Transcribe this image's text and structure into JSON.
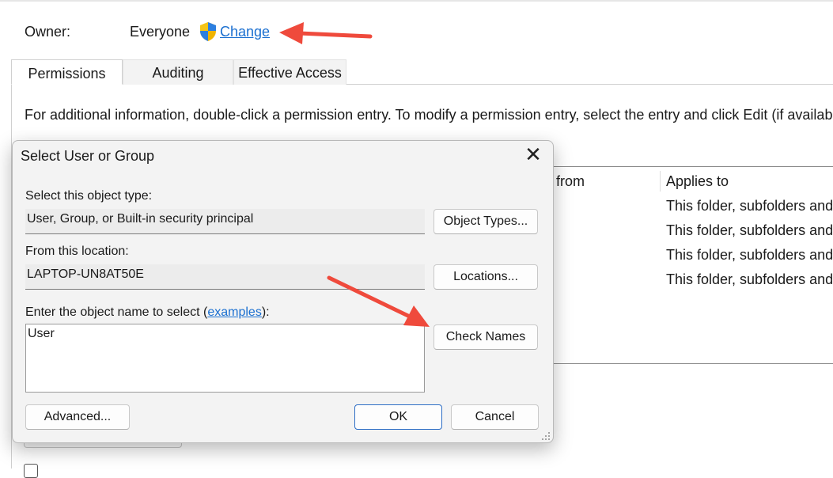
{
  "owner": {
    "label": "Owner:",
    "value": "Everyone",
    "change_link": "Change",
    "shield_icon": "uac-shield-icon"
  },
  "tabs": [
    {
      "label": "Permissions",
      "active": true
    },
    {
      "label": "Auditing",
      "active": false
    },
    {
      "label": "Effective Access",
      "active": false
    }
  ],
  "info_text": "For additional information, double-click a permission entry. To modify a permission entry, select the entry and click Edit (if availab",
  "permissions_list": {
    "columns": [
      "from",
      "Applies to"
    ],
    "rows": [
      {
        "applies_to": "This folder, subfolders and"
      },
      {
        "applies_to": "This folder, subfolders and"
      },
      {
        "applies_to": "This folder, subfolders and"
      },
      {
        "applies_to": "This folder, subfolders and"
      }
    ]
  },
  "dialog": {
    "title": "Select User or Group",
    "close_icon": "close-icon",
    "object_type_label": "Select this object type:",
    "object_type_value": "User, Group, or Built-in security principal",
    "object_types_button": "Object Types...",
    "location_label": "From this location:",
    "location_value": "LAPTOP-UN8AT50E",
    "locations_button": "Locations...",
    "object_name_label_prefix": "Enter the object name to select (",
    "object_name_label_link": "examples",
    "object_name_label_suffix": "):",
    "object_name_value": "User",
    "check_names_button": "Check Names",
    "advanced_button": "Advanced...",
    "ok_button": "OK",
    "cancel_button": "Cancel"
  },
  "colors": {
    "link": "#1a6fd0",
    "annotation_arrow": "#ef4a3c",
    "dialog_bg": "#f3f3f3",
    "primary_border": "#2b6cc4"
  }
}
